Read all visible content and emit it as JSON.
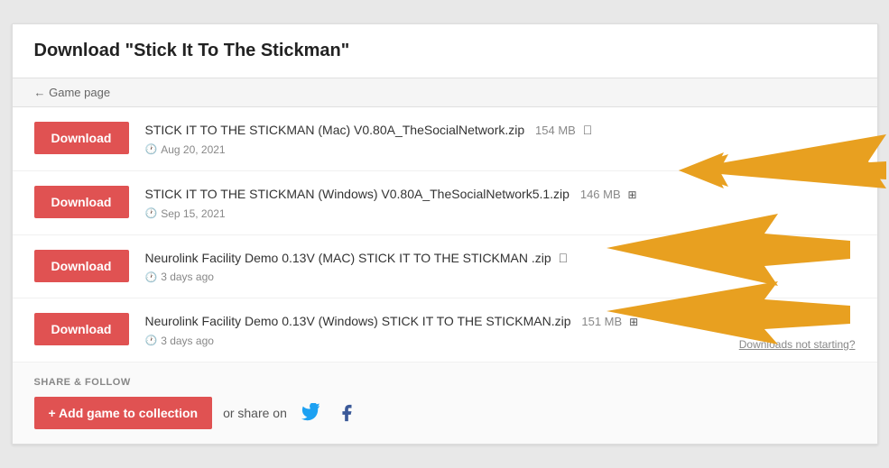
{
  "page": {
    "title_prefix": "Download ",
    "title_game": "\"Stick It To The Stickman\"",
    "back_label": "← Game page"
  },
  "downloads": [
    {
      "id": 1,
      "button_label": "Download",
      "filename": "STICK IT TO THE STICKMAN (Mac) V0.80A_TheSocialNetwork.zip",
      "size": "154 MB",
      "date": "Aug 20, 2021",
      "platform": "mac"
    },
    {
      "id": 2,
      "button_label": "Download",
      "filename": "STICK IT TO THE STICKMAN (Windows) V0.80A_TheSocialNetwork5.1.zip",
      "size": "146 MB",
      "date": "Sep 15, 2021",
      "platform": "windows"
    },
    {
      "id": 3,
      "button_label": "Download",
      "filename": "Neurolink Facility Demo 0.13V (MAC) STICK IT TO THE STICKMAN .zip",
      "size": "",
      "date": "3 days ago",
      "platform": "mac"
    },
    {
      "id": 4,
      "button_label": "Download",
      "filename": "Neurolink Facility Demo 0.13V (Windows) STICK IT TO THE STICKMAN.zip",
      "size": "151 MB",
      "date": "3 days ago",
      "platform": "windows"
    }
  ],
  "downloads_help": "Downloads not starting?",
  "share": {
    "section_label": "SHARE & FOLLOW",
    "add_button": "+ Add game to collection",
    "or_share": "or share on"
  }
}
